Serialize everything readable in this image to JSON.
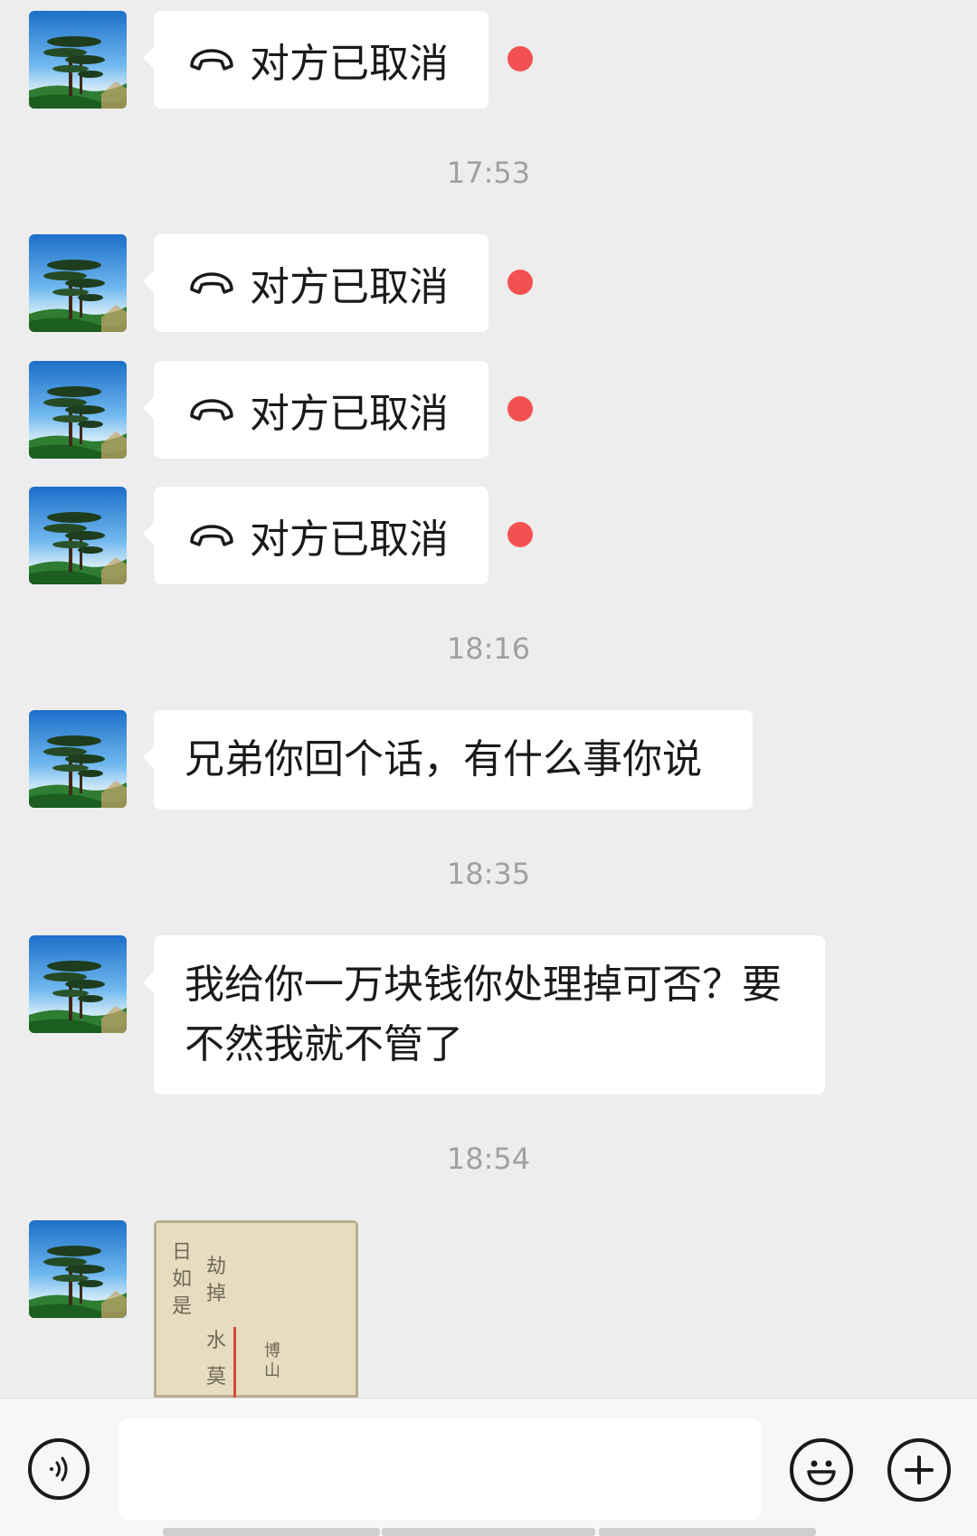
{
  "messages": {
    "call_1": {
      "text": "对方已取消"
    },
    "time_1": "17:53",
    "call_2": {
      "text": "对方已取消"
    },
    "call_3": {
      "text": "对方已取消"
    },
    "call_4": {
      "text": "对方已取消"
    },
    "time_2": "18:16",
    "text_1": {
      "line1": "兄弟你回个话，有什么事你说"
    },
    "time_3": "18:35",
    "text_2": {
      "line1": "我给你一万块钱你处理掉可否？要",
      "line2": "不然我就不管了"
    },
    "time_4": "18:54",
    "image_1": {
      "chars": [
        "日",
        "如",
        "是",
        "劫",
        "掉",
        "水",
        "莫",
        "博",
        "山"
      ]
    }
  },
  "avatar": {
    "icon": "pine-tree-landscape"
  },
  "bottom_bar": {
    "voice_icon": "voice-wave-icon",
    "emoji_icon": "smiley-icon",
    "more_icon": "plus-icon",
    "input_value": ""
  },
  "colors": {
    "background": "#ededed",
    "bubble": "#ffffff",
    "unread_dot": "#f35151",
    "timestamp": "#a0a0a0",
    "text": "#1a1a1a"
  }
}
